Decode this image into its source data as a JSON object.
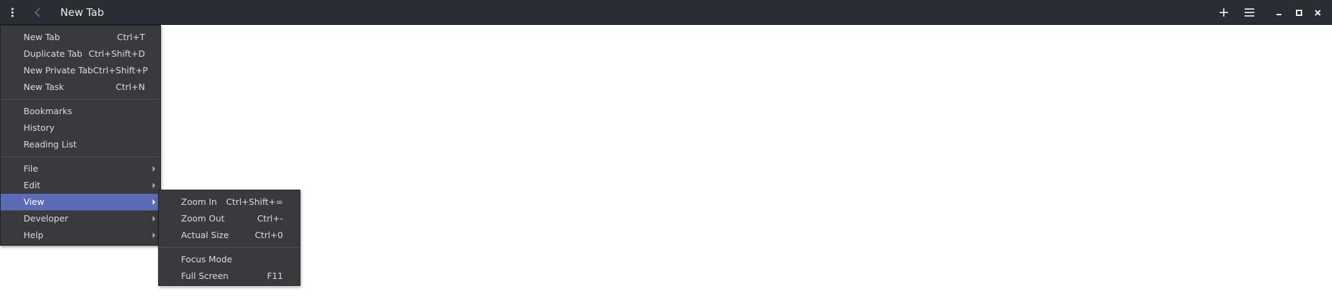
{
  "window": {
    "title": "New Tab"
  },
  "titlebar_icons": {
    "menu": "vertical-dots-icon",
    "back": "chevron-left-icon",
    "new_tab": "plus-icon",
    "hamburger": "hamburger-icon",
    "minimize": "minimize-icon",
    "maximize": "maximize-icon",
    "close": "close-icon"
  },
  "colors": {
    "titlebar_bg": "#2a2d34",
    "menu_bg": "#383a3e",
    "highlight": "#5c6bb5",
    "content_bg": "#ffffff"
  },
  "main_menu": {
    "group1": [
      {
        "label": "New Tab",
        "shortcut": "Ctrl+T"
      },
      {
        "label": "Duplicate Tab",
        "shortcut": "Ctrl+Shift+D"
      },
      {
        "label": "New Private Tab",
        "shortcut": "Ctrl+Shift+P"
      },
      {
        "label": "New Task",
        "shortcut": "Ctrl+N"
      }
    ],
    "group2": [
      {
        "label": "Bookmarks"
      },
      {
        "label": "History"
      },
      {
        "label": "Reading List"
      }
    ],
    "group3": [
      {
        "label": "File"
      },
      {
        "label": "Edit"
      },
      {
        "label": "View"
      },
      {
        "label": "Developer"
      },
      {
        "label": "Help"
      }
    ]
  },
  "view_submenu": {
    "group1": [
      {
        "label": "Zoom In",
        "shortcut": "Ctrl+Shift+="
      },
      {
        "label": "Zoom Out",
        "shortcut": "Ctrl+-"
      },
      {
        "label": "Actual Size",
        "shortcut": "Ctrl+0"
      }
    ],
    "group2": [
      {
        "label": "Focus Mode",
        "shortcut": ""
      },
      {
        "label": "Full Screen",
        "shortcut": "F11"
      }
    ]
  }
}
